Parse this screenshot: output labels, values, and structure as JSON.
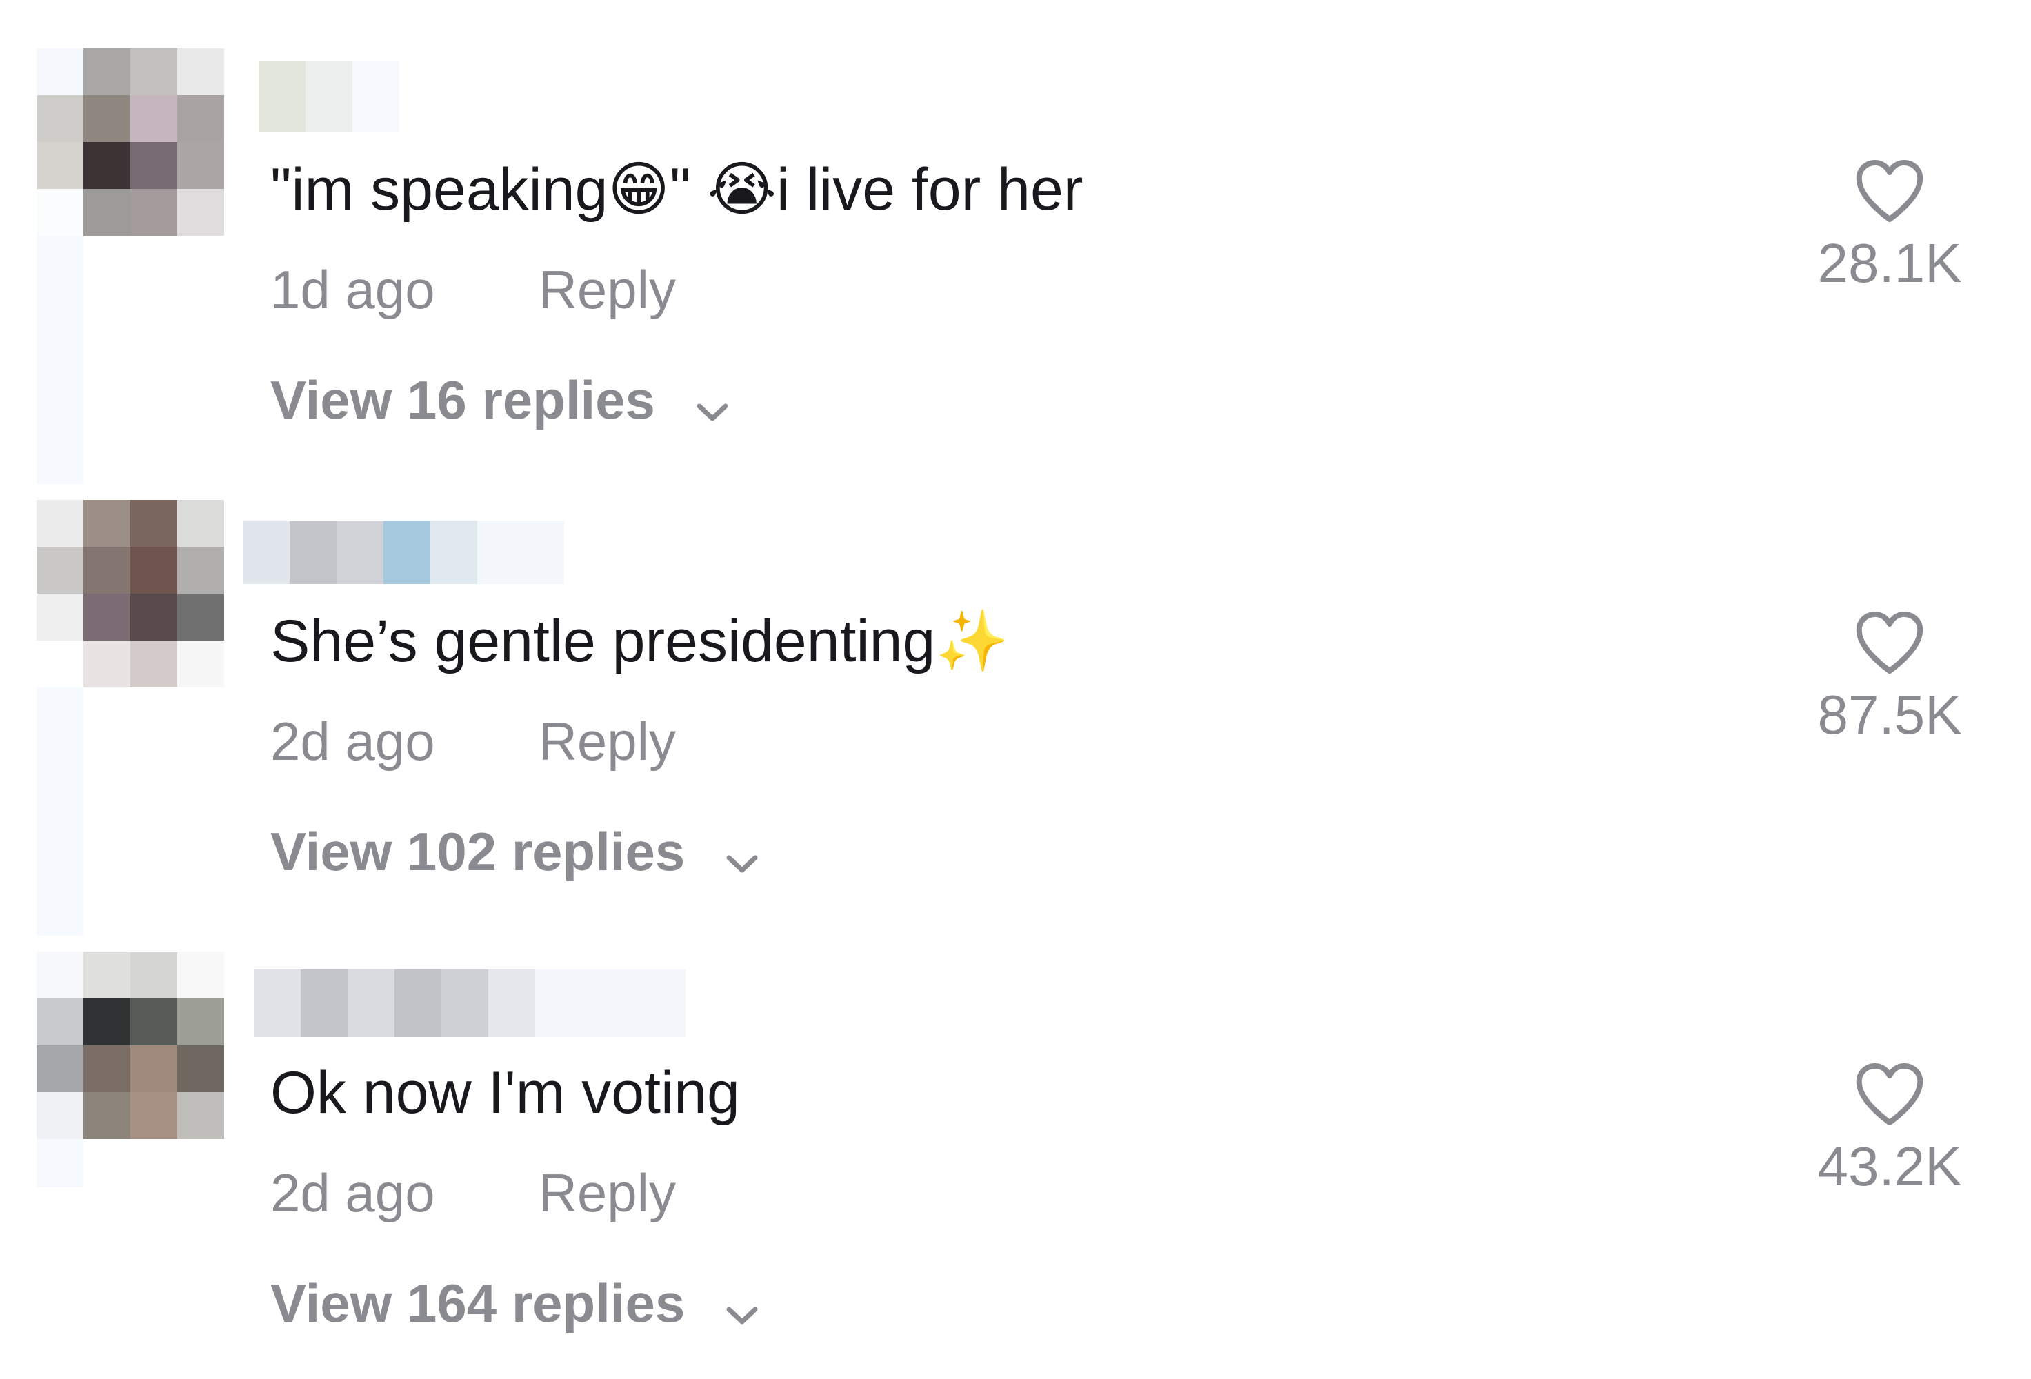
{
  "comments": [
    {
      "text": "\"im speaking😁\" 😭i live for her",
      "time": "1d ago",
      "reply_label": "Reply",
      "view_replies": "View 16 replies",
      "likes": "28.1K"
    },
    {
      "text": "She’s gentle presidenting✨",
      "time": "2d ago",
      "reply_label": "Reply",
      "view_replies": "View 102 replies",
      "likes": "87.5K"
    },
    {
      "text": "Ok now I'm voting",
      "time": "2d ago",
      "reply_label": "Reply",
      "view_replies": "View 164 replies",
      "likes": "43.2K"
    }
  ],
  "icons": {
    "like": "heart-outline-icon",
    "expand": "chevron-down-icon"
  },
  "colors": {
    "text": "#18181d",
    "secondary": "#8a8b91",
    "background": "#ffffff"
  }
}
